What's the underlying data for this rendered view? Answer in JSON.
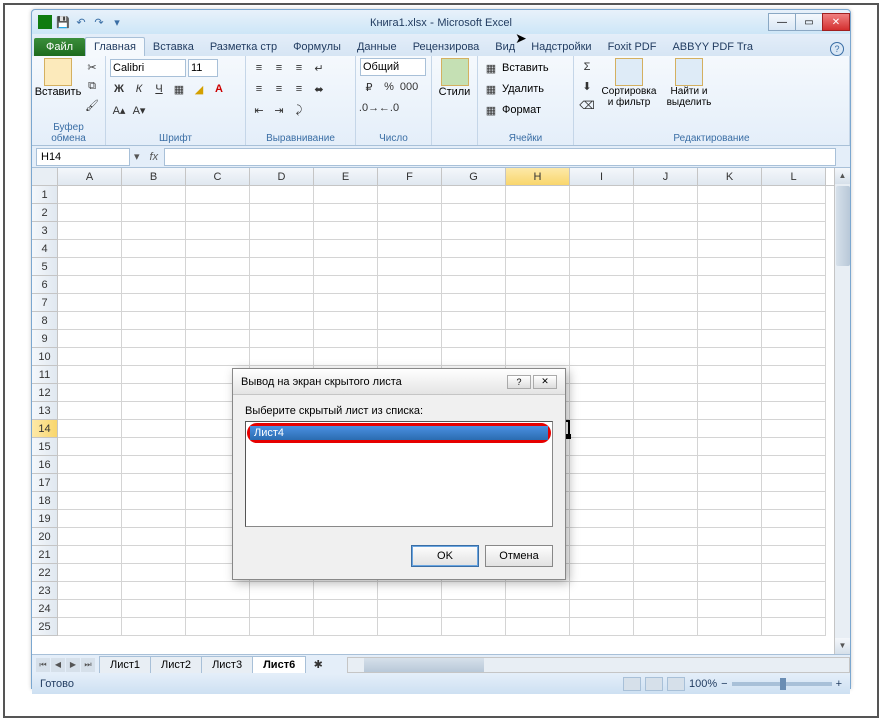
{
  "title": {
    "file": "Книга1.xlsx",
    "app": "Microsoft Excel"
  },
  "qat": {
    "save": "💾",
    "undo": "↶",
    "redo": "↷"
  },
  "tabs": {
    "file": "Файл",
    "home": "Главная",
    "insert": "Вставка",
    "layout": "Разметка стр",
    "formulas": "Формулы",
    "data": "Данные",
    "review": "Рецензирова",
    "view": "Вид",
    "addins": "Надстройки",
    "foxit": "Foxit PDF",
    "abbyy": "ABBYY PDF Tra"
  },
  "ribbon": {
    "clipboard": {
      "paste": "Вставить",
      "label": "Буфер обмена"
    },
    "font": {
      "name": "Calibri",
      "size": "11",
      "label": "Шрифт"
    },
    "align": {
      "label": "Выравнивание"
    },
    "number": {
      "format": "Общий",
      "label": "Число"
    },
    "styles": {
      "btn": "Стили",
      "label": ""
    },
    "cells": {
      "insert": "Вставить",
      "delete": "Удалить",
      "format": "Формат",
      "label": "Ячейки"
    },
    "editing": {
      "sort": "Сортировка\nи фильтр",
      "find": "Найти и\nвыделить",
      "label": "Редактирование"
    }
  },
  "namebox": "H14",
  "columns": [
    "A",
    "B",
    "C",
    "D",
    "E",
    "F",
    "G",
    "H",
    "I",
    "J",
    "K",
    "L"
  ],
  "rows": [
    "1",
    "2",
    "3",
    "4",
    "5",
    "6",
    "7",
    "8",
    "9",
    "10",
    "11",
    "12",
    "13",
    "14",
    "15",
    "16",
    "17",
    "18",
    "19",
    "20",
    "21",
    "22",
    "23",
    "24",
    "25"
  ],
  "active": {
    "col": "H",
    "row": "14"
  },
  "sheets": {
    "s1": "Лист1",
    "s2": "Лист2",
    "s3": "Лист3",
    "s6": "Лист6"
  },
  "status": {
    "ready": "Готово",
    "zoom": "100%"
  },
  "dialog": {
    "title": "Вывод на экран скрытого листа",
    "label": "Выберите скрытый лист из списка:",
    "item": "Лист4",
    "ok": "OK",
    "cancel": "Отмена"
  }
}
